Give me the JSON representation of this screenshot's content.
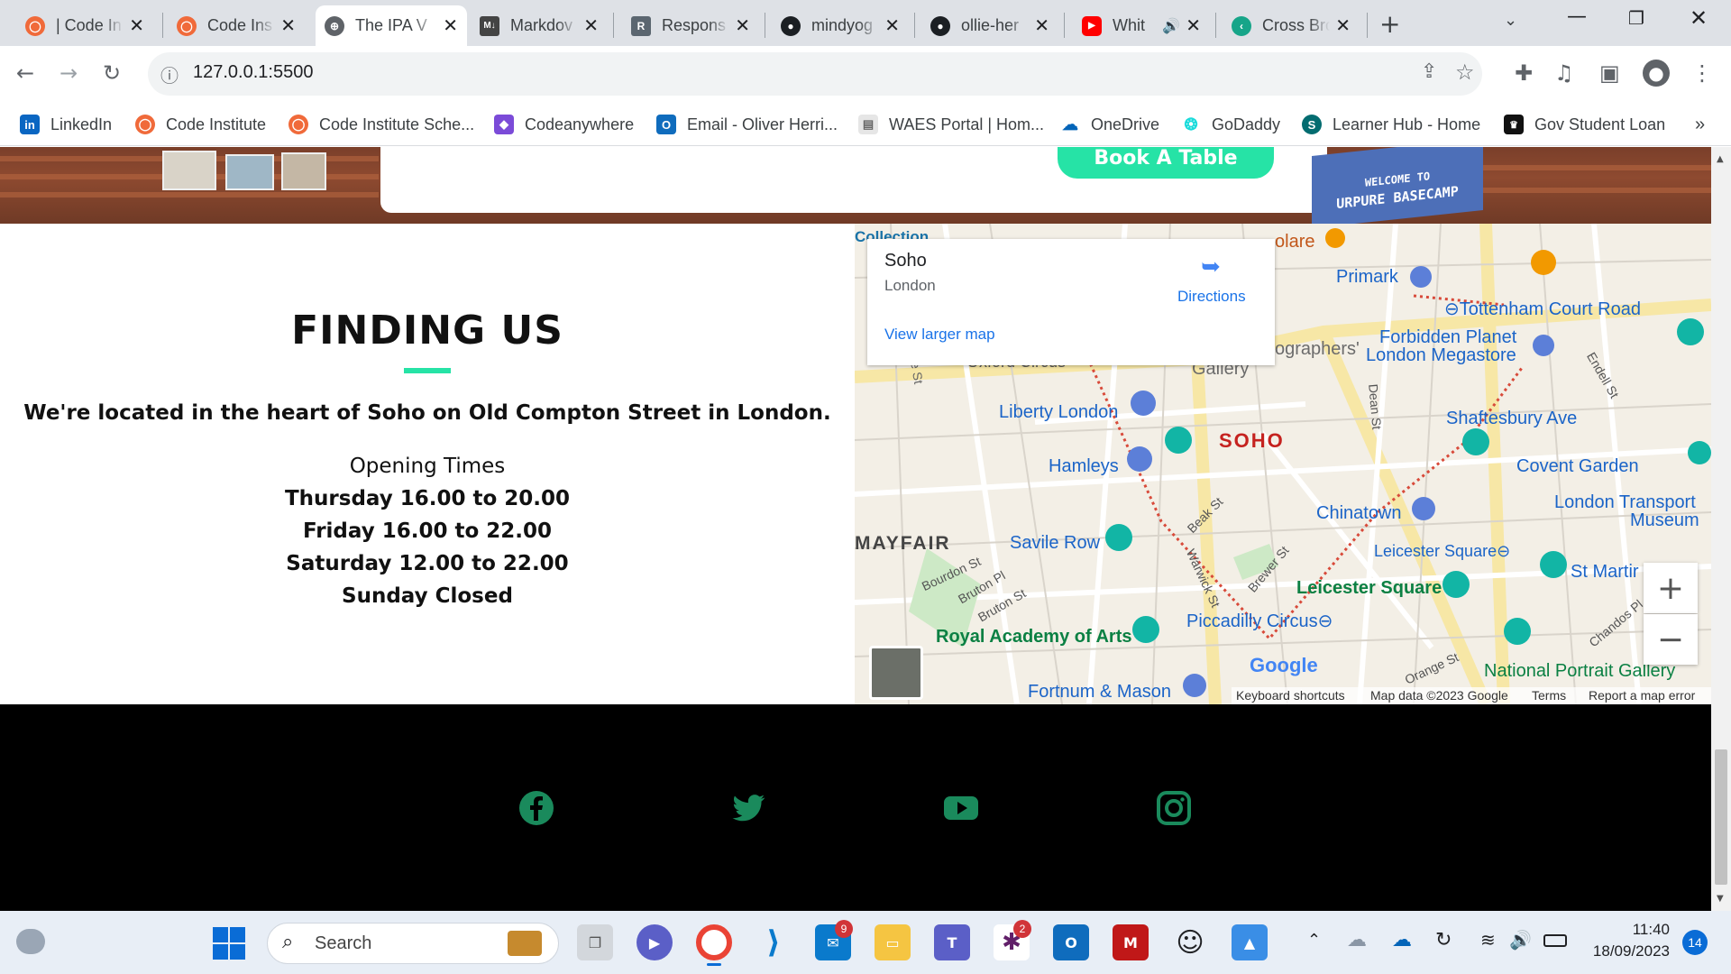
{
  "browser": {
    "tabs": [
      {
        "label": "| Code In",
        "favicon": "code-institute-icon"
      },
      {
        "label": "Code Ins",
        "favicon": "code-institute-icon"
      },
      {
        "label": "The IPA V",
        "favicon": "globe-icon",
        "active": true
      },
      {
        "label": "Markdov",
        "favicon": "markdown-icon"
      },
      {
        "label": "Respons",
        "favicon": "r-icon"
      },
      {
        "label": "mindyog",
        "favicon": "github-icon"
      },
      {
        "label": "ollie-her",
        "favicon": "github-icon"
      },
      {
        "label": "Whit",
        "favicon": "youtube-icon"
      },
      {
        "label": "Cross Bro",
        "favicon": "cross-browser-icon"
      }
    ],
    "address": "127.0.0.1:5500",
    "bookmarks": [
      {
        "label": "LinkedIn",
        "icon": "linkedin-icon"
      },
      {
        "label": "Code Institute",
        "icon": "code-institute-icon"
      },
      {
        "label": "Code Institute Sche...",
        "icon": "code-institute-icon"
      },
      {
        "label": "Codeanywhere",
        "icon": "codeanywhere-icon"
      },
      {
        "label": "Email - Oliver Herri...",
        "icon": "outlook-icon"
      },
      {
        "label": "WAES Portal | Hom...",
        "icon": "waes-icon"
      },
      {
        "label": "OneDrive",
        "icon": "onedrive-icon"
      },
      {
        "label": "GoDaddy",
        "icon": "godaddy-icon"
      },
      {
        "label": "Learner Hub - Home",
        "icon": "sharepoint-icon"
      },
      {
        "label": "Gov Student Loan",
        "icon": "gov-icon"
      }
    ],
    "more_bookmarks": "»"
  },
  "page": {
    "book_button": "Book A Table",
    "sign_text_1": "WELCOME TO",
    "sign_text_2": "URPURE BASECAMP",
    "finding": {
      "heading": "FINDING US",
      "location": "We're located in the heart of Soho on Old Compton Street in London.",
      "times_title": "Opening Times",
      "times": [
        "Thursday 16.00 to 20.00",
        "Friday 16.00 to 22.00",
        "Saturday 12.00 to 22.00",
        "Sunday Closed"
      ]
    },
    "map": {
      "place_name": "Soho",
      "place_sub": "London",
      "directions": "Directions",
      "larger_map": "View larger map",
      "labels": {
        "collection": "Collection",
        "olare": "olare",
        "primark": "Primark",
        "tottenham": "Tottenham Court Road",
        "forbidden_1": "Forbidden Planet",
        "forbidden_2": "London Megastore",
        "photographers": "ographers'",
        "gallery": "Gallery",
        "oxford": "Oxford Circus",
        "shaftesbury": "Shaftesbury Ave",
        "endell": "Endell St",
        "liberty": "Liberty London",
        "soho": "SOHO",
        "hamleys": "Hamleys",
        "covent": "Covent Garden",
        "ltm_1": "London Transport",
        "ltm_2": "Museum",
        "chinatown": "Chinatown",
        "mayfair": "MAYFAIR",
        "savile": "Savile Row",
        "beak": "Beak St",
        "warwick": "Warwick St",
        "brewer": "Brewer St",
        "leicester1": "Leicester Square",
        "leicester2": "Leicester Square",
        "st_martin": "St Martir",
        "bourdon": "Bourdon St",
        "bruton_pl": "Bruton Pl",
        "bruton_st": "Bruton St",
        "dean": "Dean St",
        "piccadilly": "Piccadilly Circus",
        "royal_academy": "Royal Academy of Arts",
        "google": "Google",
        "orange": "Orange St",
        "chandos": "Chandos Pl",
        "npg": "National Portrait Gallery",
        "fortnum": "Fortnum & Mason",
        "re_st": "re St"
      },
      "attribution": {
        "keyboard": "Keyboard shortcuts",
        "mapdata": "Map data ©2023 Google",
        "terms": "Terms",
        "report": "Report a map error"
      },
      "zoom_in": "+",
      "zoom_out": "−"
    },
    "social": [
      "facebook-icon",
      "twitter-icon",
      "youtube-icon",
      "instagram-icon"
    ]
  },
  "taskbar": {
    "search_placeholder": "Search",
    "time": "11:40",
    "date": "18/09/2023",
    "notifications": "14",
    "mail_badge": "9",
    "slack_badge": "2"
  },
  "colors": {
    "accent": "#26e3a6",
    "social": "#1a8a5c",
    "link": "#1a73e8"
  }
}
